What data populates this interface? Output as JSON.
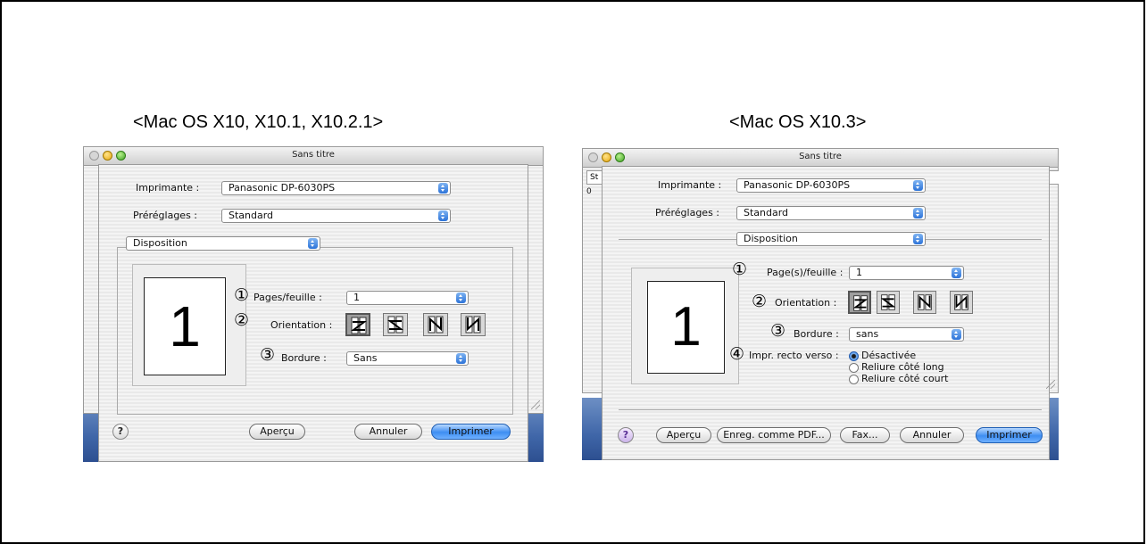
{
  "headings": {
    "left": "<Mac OS X10, X10.1, X10.2.1>",
    "right": "<Mac OS X10.3>"
  },
  "left_dialog": {
    "window_title": "Sans titre",
    "printer_label": "Imprimante :",
    "printer_value": "Panasonic DP-6030PS",
    "presets_label": "Préréglages :",
    "presets_value": "Standard",
    "panel_value": "Disposition",
    "preview_page": "1",
    "markers": [
      "1",
      "2",
      "3"
    ],
    "pages_label": "Pages/feuille :",
    "pages_value": "1",
    "orientation_label": "Orientation :",
    "border_label": "Bordure :",
    "border_value": "Sans",
    "help_label": "?",
    "preview_button": "Aperçu",
    "cancel_button": "Annuler",
    "print_button": "Imprimer"
  },
  "right_dialog": {
    "window_title": "Sans titre",
    "bg_toolbar_fragment": "St",
    "bg_ruler_fragment": "0",
    "printer_label": "Imprimante :",
    "printer_value": "Panasonic DP-6030PS",
    "presets_label": "Préréglages :",
    "presets_value": "Standard",
    "panel_value": "Disposition",
    "preview_page": "1",
    "markers": [
      "1",
      "2",
      "3",
      "4"
    ],
    "pages_label": "Page(s)/feuille :",
    "pages_value": "1",
    "orientation_label": "Orientation :",
    "border_label": "Bordure :",
    "border_value": "sans",
    "duplex_label": "Impr. recto verso :",
    "duplex_options": [
      "Désactivée",
      "Reliure côté long",
      "Reliure côté court"
    ],
    "duplex_selected": "Désactivée",
    "help_label": "?",
    "preview_button": "Aperçu",
    "pdf_button": "Enreg. comme PDF...",
    "fax_button": "Fax...",
    "cancel_button": "Annuler",
    "print_button": "Imprimer"
  },
  "orientation_icons": [
    "z-orientation-icon",
    "reverse-z-orientation-icon",
    "reverse-n-orientation-icon",
    "n-orientation-icon"
  ],
  "colors": {
    "accent": "#3e8ef2",
    "desktop": "#3f66a8"
  }
}
